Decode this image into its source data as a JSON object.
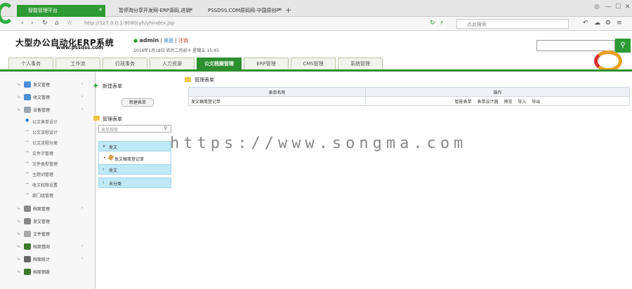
{
  "browser": {
    "tabs": [
      {
        "label": "智能管理平台",
        "active": true
      },
      {
        "label": "暂停淘分享开发网-ERP源码,进销",
        "active": false
      },
      {
        "label": "PSSDSS.COM原码网-中国原创P",
        "active": false
      }
    ],
    "new_tab": "+",
    "url": "http://127.0.0.1:8080/yh/yhindex.jsp",
    "search_placeholder": "点此搜索"
  },
  "app": {
    "brand": "大型办公自动化ERP系统",
    "brand_url": "www.pssdss.com",
    "user": "admin",
    "tools": [
      "桌面",
      "注销"
    ],
    "date": "2016年1月18日   农历二月初十   星期五   15:45",
    "topsearch_icon": "search-icon"
  },
  "nav": {
    "tabs": [
      "个人事务",
      "工作流",
      "行政事务",
      "人力资源",
      "公文档案管理",
      "ERP管理",
      "CMS管理",
      "系统管理"
    ],
    "active_index": 4
  },
  "sidebar": {
    "groups": [
      {
        "label": "发文管理",
        "icon_color": "#4c8fd6"
      },
      {
        "label": "收文管理",
        "icon_color": "#4c8fd6"
      },
      {
        "label": "设备管理",
        "icon_color": "#9aa4ae"
      }
    ],
    "subs": [
      "公文表单设计",
      "公文流程设计",
      "公文流程分类",
      "文件字管理",
      "文件类型管理",
      "主题词管理",
      "收文权限设置",
      "部门组管理"
    ],
    "active_sub": 0,
    "groups2": [
      {
        "label": "档案管理",
        "icon_color": "#888888"
      },
      {
        "label": "发文管理",
        "icon_color": "#888888"
      },
      {
        "label": "文件管理",
        "icon_color": "#aaaaaa"
      },
      {
        "label": "档案借阅",
        "icon_color": "#3b7a2e"
      },
      {
        "label": "档案统计",
        "icon_color": "#666666"
      },
      {
        "label": "档案销毁",
        "icon_color": "#3b7a2e"
      }
    ]
  },
  "middle": {
    "new_title": "新建表单",
    "new_button": "新建表单",
    "manage_title": "管理表单",
    "search_placeholder": "表单搜索",
    "sections": [
      {
        "label": "发文",
        "items": [
          "发文稿笺登记单"
        ]
      },
      {
        "label": "收文",
        "items": []
      },
      {
        "label": "未分类",
        "items": []
      }
    ]
  },
  "content": {
    "title": "管理表单",
    "columns": [
      "表单名称",
      "操作"
    ],
    "rows": [
      {
        "name": "发文稿笺登记单",
        "ops": [
          "智能表单",
          "表单设计器",
          "预览",
          "导入",
          "导出"
        ]
      }
    ]
  },
  "watermark": "https://www.songma.com"
}
